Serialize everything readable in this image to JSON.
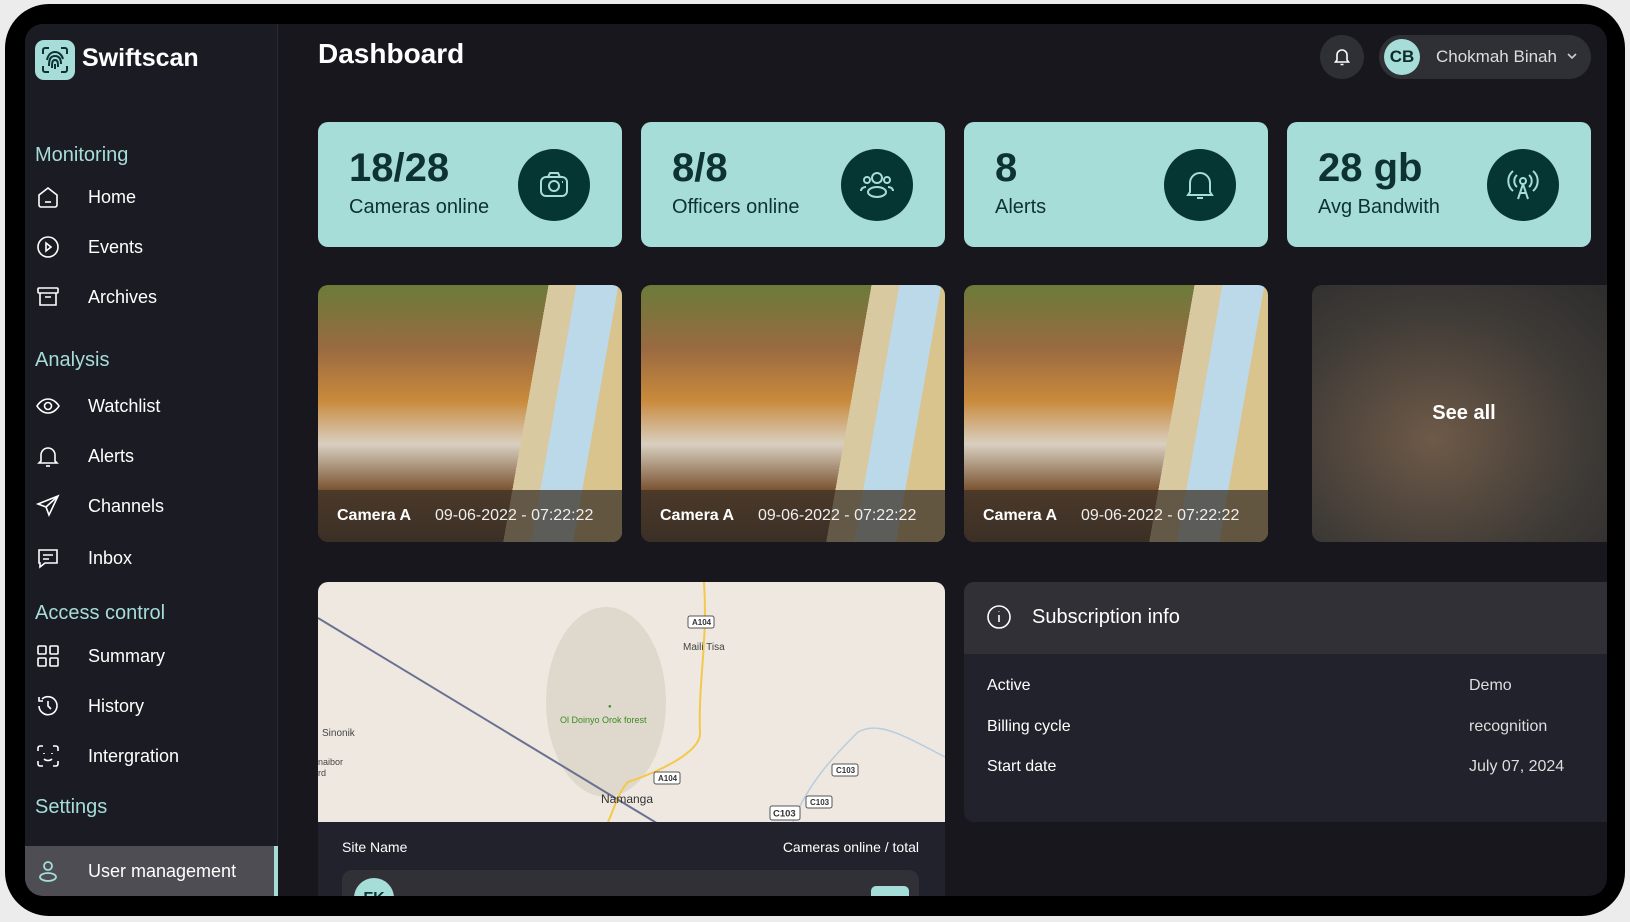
{
  "brand": {
    "name": "Swiftscan",
    "accent": "#a6ddd8"
  },
  "sidebar": {
    "sections": [
      {
        "title": "Monitoring",
        "items": [
          {
            "label": "Home",
            "icon": "home-icon"
          },
          {
            "label": "Events",
            "icon": "play-circle-icon"
          },
          {
            "label": "Archives",
            "icon": "archive-icon"
          }
        ]
      },
      {
        "title": "Analysis",
        "items": [
          {
            "label": "Watchlist",
            "icon": "eye-icon"
          },
          {
            "label": "Alerts",
            "icon": "bell-icon"
          },
          {
            "label": "Channels",
            "icon": "send-icon"
          },
          {
            "label": "Inbox",
            "icon": "message-icon"
          }
        ]
      },
      {
        "title": "Access control",
        "items": [
          {
            "label": "Summary",
            "icon": "grid-icon"
          },
          {
            "label": "History",
            "icon": "history-icon"
          },
          {
            "label": "Intergration",
            "icon": "face-scan-icon"
          }
        ]
      },
      {
        "title": "Settings",
        "items": [
          {
            "label": "User management",
            "icon": "user-icon",
            "active": true
          }
        ]
      }
    ]
  },
  "header": {
    "title": "Dashboard",
    "user": {
      "initials": "CB",
      "name": "Chokmah Binah"
    }
  },
  "stats": [
    {
      "value": "18/28",
      "label": "Cameras online",
      "icon": "camera-icon"
    },
    {
      "value": "8/8",
      "label": "Officers online",
      "icon": "users-icon"
    },
    {
      "value": "8",
      "label": "Alerts",
      "icon": "bell-icon"
    },
    {
      "value": "28 gb",
      "label": "Avg Bandwith",
      "icon": "antenna-icon"
    }
  ],
  "cameras": [
    {
      "name": "Camera A",
      "time": "09-06-2022 - 07:22:22"
    },
    {
      "name": "Camera A",
      "time": "09-06-2022 - 07:22:22"
    },
    {
      "name": "Camera A",
      "time": "09-06-2022 - 07:22:22"
    }
  ],
  "see_all": "See all",
  "map": {
    "labels": {
      "road1": "A104",
      "road2": "A104",
      "town1": "Maili Tisa",
      "forest": "Ol Doinyo Orok forest",
      "town2": "Sinonik",
      "town3": "naibor",
      "town3b": "rd",
      "town4": "Namanga",
      "c1": "C103",
      "c2": "C103",
      "c3": "C103"
    }
  },
  "sites": {
    "col_name": "Site Name",
    "col_cameras": "Cameras online / total",
    "rows": [
      {
        "initials": "FK"
      }
    ]
  },
  "subscription": {
    "title": "Subscription info",
    "rows": [
      {
        "key": "Active",
        "value": "Demo"
      },
      {
        "key": "Billing cycle",
        "value": "recognition"
      },
      {
        "key": "Start date",
        "value": "July 07, 2024"
      }
    ]
  }
}
